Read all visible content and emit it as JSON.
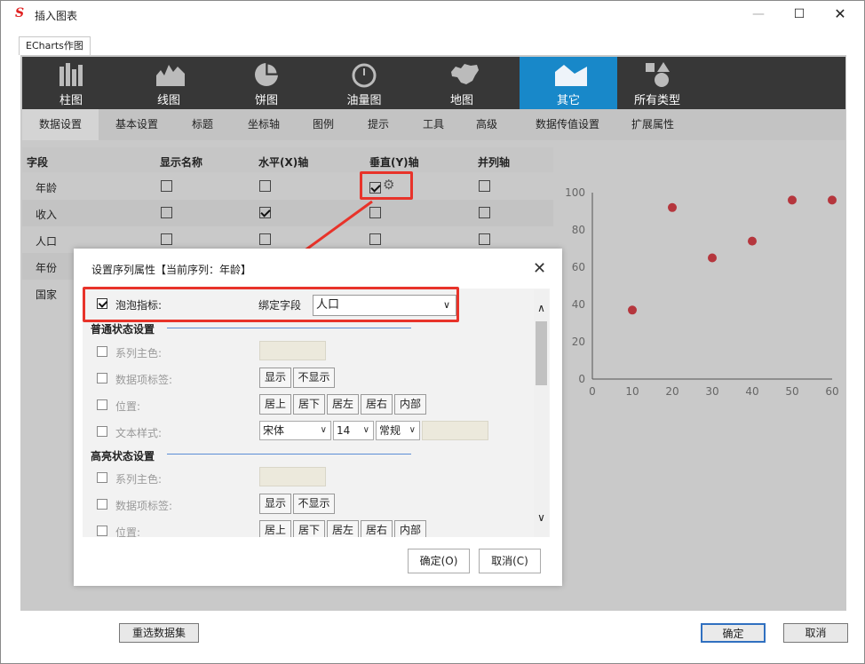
{
  "window": {
    "title": "插入图表",
    "logo": "S"
  },
  "main_tab": "ECharts作图",
  "chart_types": [
    {
      "label": "柱图",
      "icon": "bar-chart-icon"
    },
    {
      "label": "线图",
      "icon": "line-chart-icon"
    },
    {
      "label": "饼图",
      "icon": "pie-chart-icon"
    },
    {
      "label": "油量图",
      "icon": "gauge-icon"
    },
    {
      "label": "地图",
      "icon": "map-icon"
    },
    {
      "label": "其它",
      "icon": "other-chart-icon",
      "active": true
    },
    {
      "label": "所有类型",
      "icon": "all-types-icon"
    }
  ],
  "setting_tabs": [
    "数据设置",
    "基本设置",
    "标题",
    "坐标轴",
    "图例",
    "提示",
    "工具",
    "高级",
    "数据传值设置",
    "扩展属性"
  ],
  "fields_table": {
    "headers": [
      "字段",
      "显示名称",
      "水平(X)轴",
      "垂直(Y)轴",
      "并列轴"
    ],
    "rows": [
      {
        "name": "年龄",
        "display": false,
        "x": false,
        "y": true,
        "parallel": false
      },
      {
        "name": "收入",
        "display": false,
        "x": true,
        "y": false,
        "parallel": false
      },
      {
        "name": "人口",
        "display": false,
        "x": false,
        "y": false,
        "parallel": false
      },
      {
        "name": "年份"
      },
      {
        "name": "国家"
      }
    ]
  },
  "chart_data": {
    "type": "scatter",
    "x": [
      10,
      20,
      30,
      40,
      50,
      60
    ],
    "y": [
      37,
      92,
      65,
      74,
      96,
      96
    ],
    "xlim": [
      0,
      60
    ],
    "ylim": [
      0,
      100
    ],
    "xticks": [
      "0",
      "10",
      "20",
      "30",
      "40",
      "50",
      "60"
    ],
    "yticks": [
      "0",
      "20",
      "40",
      "60",
      "80",
      "100"
    ],
    "point_color": "#b5363d",
    "grid": false
  },
  "dialog": {
    "title": "设置序列属性【当前序列：年龄】",
    "bubble_label": "泡泡指标:",
    "bind_field_label": "绑定字段",
    "bind_field_value": "人口",
    "normal_section": "普通状态设置",
    "highlight_section": "高亮状态设置",
    "series_color_label": "系列主色:",
    "data_label_label": "数据项标签:",
    "position_label": "位置:",
    "text_style_label": "文本样式:",
    "show_btn": "显示",
    "hide_btn": "不显示",
    "positions": [
      "居上",
      "居下",
      "居左",
      "居右",
      "内部"
    ],
    "font_family": "宋体",
    "font_size": "14",
    "font_weight": "常规",
    "ok": "确定(O)",
    "cancel": "取消(C)"
  },
  "bottom": {
    "reselect": "重选数据集",
    "ok": "确定",
    "cancel": "取消"
  },
  "colors": {
    "accent": "#1888c9",
    "highlight": "#e8332a",
    "dark_bar": "#373737"
  }
}
